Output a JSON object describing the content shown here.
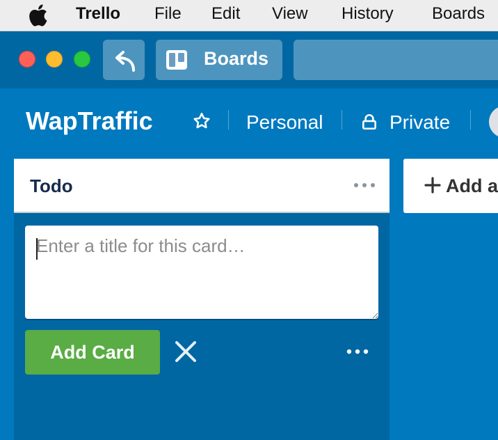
{
  "menubar": {
    "app_name": "Trello",
    "items": [
      "File",
      "Edit",
      "View",
      "History",
      "Boards"
    ]
  },
  "toolbar": {
    "boards_label": "Boards"
  },
  "board": {
    "title": "WapTraffic",
    "team": "Personal",
    "visibility": "Private"
  },
  "list": {
    "title": "Todo",
    "composer": {
      "placeholder": "Enter a title for this card…",
      "value": "",
      "add_label": "Add Card"
    }
  },
  "add_list": {
    "label": "Add a"
  },
  "colors": {
    "board_bg": "#0079bf",
    "toolbar_bg": "#0067a3",
    "add_button": "#5aac44"
  },
  "icons": {
    "apple": "apple-logo-icon",
    "back": "back-arrow-icon",
    "boards": "boards-icon",
    "star": "star-icon",
    "lock": "lock-icon",
    "more": "ellipsis-icon",
    "close": "close-icon",
    "plus": "plus-icon"
  }
}
